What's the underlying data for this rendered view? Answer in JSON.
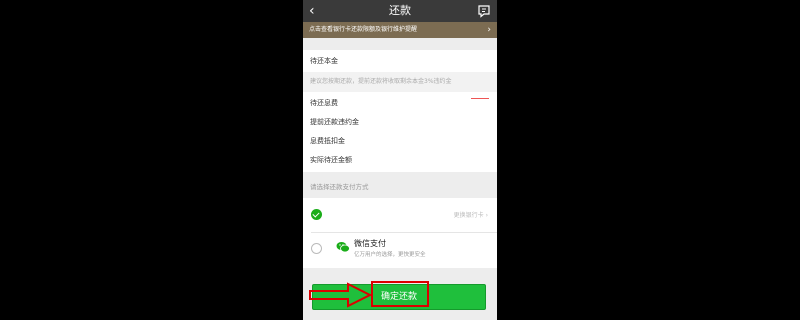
{
  "header": {
    "title": "还款"
  },
  "notice": {
    "text": "点击查看银行卡还款限额及银行维护提醒"
  },
  "repay": {
    "principal_label": "待还本金",
    "hint": "建议您按期还款，提前还款将收取剩余本金3%违约金",
    "interest_label": "待还息费",
    "penalty_label": "提前还款违约金",
    "discount_label": "息费抵扣金",
    "actual_label": "实际待还金额"
  },
  "payment": {
    "section_label": "请选择还款支付方式",
    "change_card_label": "更换银行卡",
    "wechat_name": "微信支付",
    "wechat_desc": "亿万用户的选择，更快更安全"
  },
  "confirm_label": "确定还款",
  "colors": {
    "accent": "#1fbf3c",
    "notice_bg": "#7c6c52",
    "highlight": "#dd0000"
  }
}
